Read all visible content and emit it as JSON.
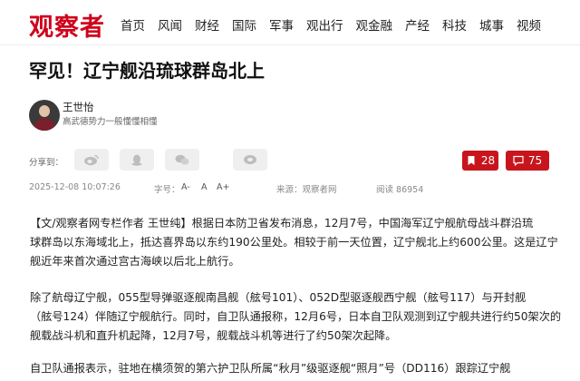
{
  "header": {
    "logo": "观察者",
    "nav": [
      "首页",
      "风闻",
      "财经",
      "国际",
      "军事",
      "观出行",
      "观金融",
      "产经",
      "科技",
      "城事",
      "视频"
    ]
  },
  "article": {
    "title": "罕见！辽宁舰沿琉球群岛北上",
    "author": {
      "name": "王世怡",
      "desc": "高武德势力一般懂懂相懂"
    },
    "share_label": "分享到：",
    "share_buttons": [
      "weibo-icon",
      "qq-icon",
      "wechat-icon",
      "more-icon"
    ],
    "likes": "28",
    "comments": "75",
    "meta": {
      "datetime": "2025-12-08 10:07:26",
      "font_label": "字号：",
      "font_small": "A-",
      "font_normal": "A",
      "font_large": "A+",
      "source": "来源：观察者网",
      "views": "阅读 86954"
    },
    "paragraphs": [
      "【文/观察者网专栏作者 王世纯】根据日本防卫省发布消息，12月7号，中国海军辽宁舰航母战斗群沿琉\n球群岛以东海域北上，抵达喜界岛以东约190公里处。相较于前一天位置，辽宁舰北上约600公里。这是辽宁\n舰近年来首次通过宫古海峡以后北上航行。",
      "除了航母辽宁舰，055型导弹驱逐舰南昌舰（舷号101）、052D型驱逐舰西宁舰（舷号117）与开封舰\n（舷号124）伴随辽宁舰航行。同时，自卫队通报称，12月6号，日本自卫队观测到辽宁舰共进行约50架次的\n舰载战斗机和直升机起降，12月7号，舰载战斗机等进行了约50架次起降。",
      "自卫队通报表示，驻地在横须贺的第六护卫队所属“秋月”级驱逐舰“照月”号（DD116）跟踪辽宁舰"
    ]
  },
  "colors": {
    "brand": "#d0021b",
    "pill": "#c8151d"
  }
}
